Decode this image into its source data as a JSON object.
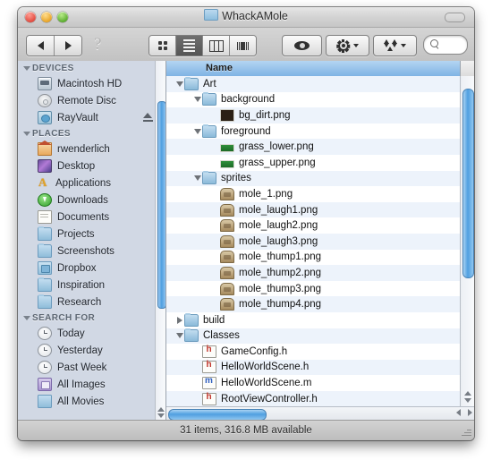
{
  "window": {
    "title": "WhackAMole",
    "title_icon": "folder-icon",
    "traffic_lights": [
      "close-button",
      "minimize-button",
      "zoom-button"
    ],
    "toolbar_toggle": "toolbar-toggle-button"
  },
  "toolbar": {
    "back": "back-button",
    "forward": "forward-button",
    "help": "?",
    "view_modes": [
      {
        "name": "icon-view",
        "selected": false
      },
      {
        "name": "list-view",
        "selected": true
      },
      {
        "name": "column-view",
        "selected": false
      },
      {
        "name": "coverflow-view",
        "selected": false
      }
    ],
    "quicklook": "quick-look-button",
    "action": "action-menu-button",
    "dropbox": "dropbox-menu-button",
    "search": {
      "value": "",
      "placeholder": ""
    }
  },
  "sidebar": {
    "sections": [
      {
        "label": "DEVICES",
        "items": [
          {
            "label": "Macintosh HD",
            "icon": "hard-disk-icon",
            "eject": false
          },
          {
            "label": "Remote Disc",
            "icon": "optical-disc-icon",
            "eject": false
          },
          {
            "label": "RayVault",
            "icon": "disk-image-icon",
            "eject": true
          }
        ]
      },
      {
        "label": "PLACES",
        "items": [
          {
            "label": "rwenderlich",
            "icon": "home-icon",
            "eject": false
          },
          {
            "label": "Desktop",
            "icon": "desktop-icon",
            "eject": false
          },
          {
            "label": "Applications",
            "icon": "applications-icon",
            "eject": false
          },
          {
            "label": "Downloads",
            "icon": "downloads-icon",
            "eject": false
          },
          {
            "label": "Documents",
            "icon": "documents-icon",
            "eject": false
          },
          {
            "label": "Projects",
            "icon": "folder-icon",
            "eject": false
          },
          {
            "label": "Screenshots",
            "icon": "folder-icon",
            "eject": false
          },
          {
            "label": "Dropbox",
            "icon": "dropbox-folder-icon",
            "eject": false
          },
          {
            "label": "Inspiration",
            "icon": "folder-icon",
            "eject": false
          },
          {
            "label": "Research",
            "icon": "folder-icon",
            "eject": false
          }
        ]
      },
      {
        "label": "SEARCH FOR",
        "items": [
          {
            "label": "Today",
            "icon": "clock-icon",
            "eject": false
          },
          {
            "label": "Yesterday",
            "icon": "clock-icon",
            "eject": false
          },
          {
            "label": "Past Week",
            "icon": "clock-icon",
            "eject": false
          },
          {
            "label": "All Images",
            "icon": "images-icon",
            "eject": false
          },
          {
            "label": "All Movies",
            "icon": "movies-icon",
            "eject": false
          }
        ]
      }
    ]
  },
  "file_list": {
    "column_header": "Name",
    "rows": [
      {
        "label": "Art",
        "indent": 0,
        "icon": "folder-icon",
        "twisty": "open"
      },
      {
        "label": "background",
        "indent": 1,
        "icon": "folder-icon",
        "twisty": "open"
      },
      {
        "label": "bg_dirt.png",
        "indent": 2,
        "icon": "image-dark-icon",
        "twisty": "none"
      },
      {
        "label": "foreground",
        "indent": 1,
        "icon": "folder-icon",
        "twisty": "open"
      },
      {
        "label": "grass_lower.png",
        "indent": 2,
        "icon": "image-green-icon",
        "twisty": "none"
      },
      {
        "label": "grass_upper.png",
        "indent": 2,
        "icon": "image-green-icon",
        "twisty": "none"
      },
      {
        "label": "sprites",
        "indent": 1,
        "icon": "folder-icon",
        "twisty": "open"
      },
      {
        "label": "mole_1.png",
        "indent": 2,
        "icon": "image-mole-icon",
        "twisty": "none"
      },
      {
        "label": "mole_laugh1.png",
        "indent": 2,
        "icon": "image-mole-icon",
        "twisty": "none"
      },
      {
        "label": "mole_laugh2.png",
        "indent": 2,
        "icon": "image-mole-icon",
        "twisty": "none"
      },
      {
        "label": "mole_laugh3.png",
        "indent": 2,
        "icon": "image-mole-icon",
        "twisty": "none"
      },
      {
        "label": "mole_thump1.png",
        "indent": 2,
        "icon": "image-mole-icon",
        "twisty": "none"
      },
      {
        "label": "mole_thump2.png",
        "indent": 2,
        "icon": "image-mole-icon",
        "twisty": "none"
      },
      {
        "label": "mole_thump3.png",
        "indent": 2,
        "icon": "image-mole-icon",
        "twisty": "none"
      },
      {
        "label": "mole_thump4.png",
        "indent": 2,
        "icon": "image-mole-icon",
        "twisty": "none"
      },
      {
        "label": "build",
        "indent": 0,
        "icon": "folder-icon",
        "twisty": "closed"
      },
      {
        "label": "Classes",
        "indent": 0,
        "icon": "folder-icon",
        "twisty": "open"
      },
      {
        "label": "GameConfig.h",
        "indent": 1,
        "icon": "header-file-icon",
        "twisty": "none"
      },
      {
        "label": "HelloWorldScene.h",
        "indent": 1,
        "icon": "header-file-icon",
        "twisty": "none"
      },
      {
        "label": "HelloWorldScene.m",
        "indent": 1,
        "icon": "source-file-icon",
        "twisty": "none"
      },
      {
        "label": "RootViewController.h",
        "indent": 1,
        "icon": "header-file-icon",
        "twisty": "none"
      }
    ]
  },
  "status_bar": {
    "text": "31 items, 316.8 MB available"
  },
  "colors": {
    "header_blue": "#7fb3e4",
    "scroll_blue": "#4f9fe0",
    "sidebar_bg": "#d1d8e4",
    "row_stripe": "#edf3fb"
  }
}
